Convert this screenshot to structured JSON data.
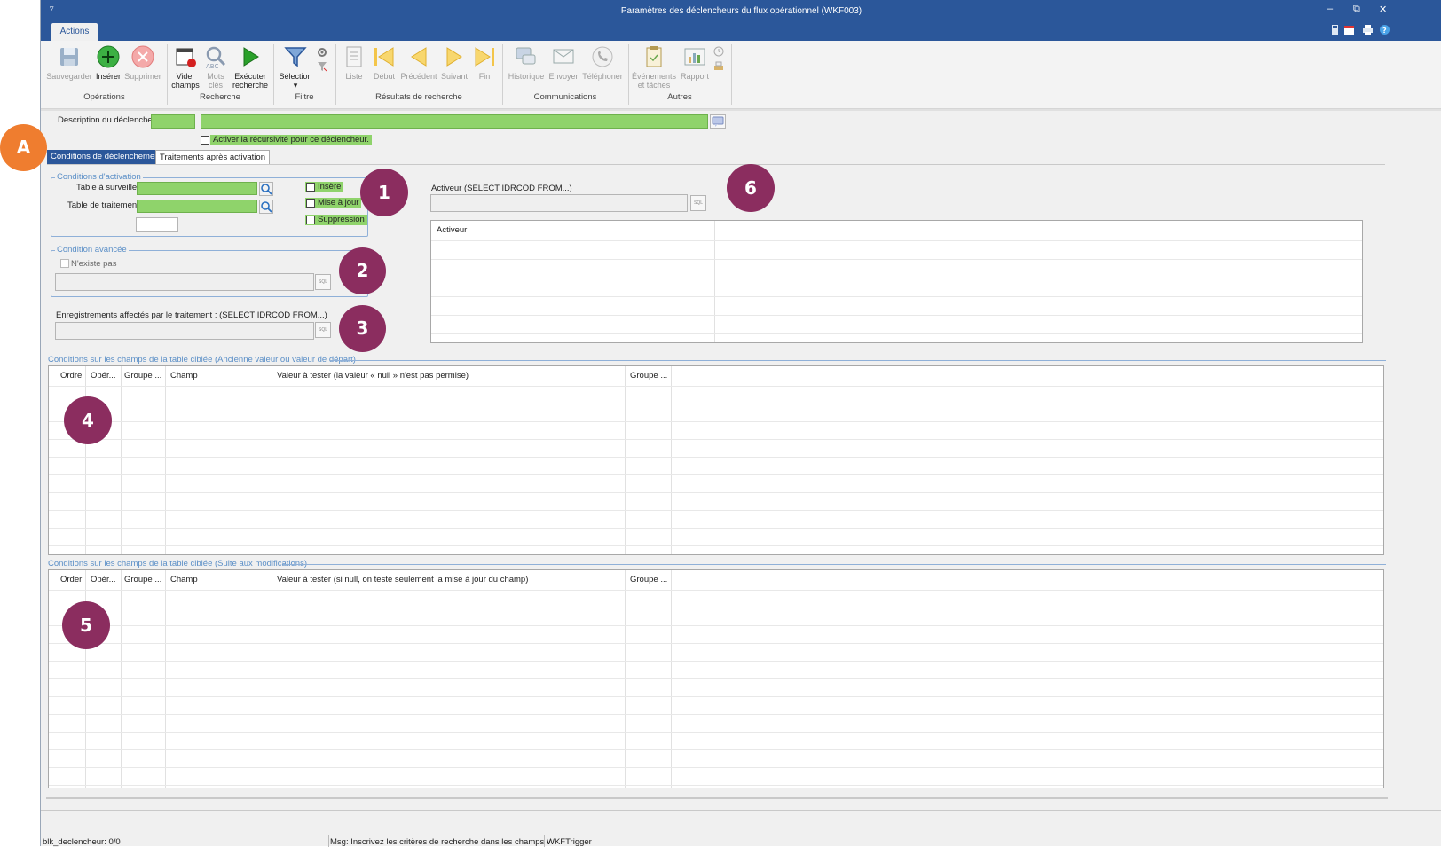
{
  "window": {
    "title": "Paramètres des déclencheurs du flux opérationnel (WKF003)",
    "quick_access": "▿",
    "controls": {
      "minimize": "–",
      "restore": "⧉",
      "close": "✕"
    }
  },
  "ribbon": {
    "tab": "Actions",
    "groups": {
      "operations": "Opérations",
      "recherche": "Recherche",
      "filtre": "Filtre",
      "resultats": "Résultats de recherche",
      "communications": "Communications",
      "autres": "Autres"
    },
    "buttons": {
      "sauvegarder": "Sauvegarder",
      "inserer": "Insérer",
      "supprimer": "Supprimer",
      "vider_1": "Vider",
      "vider_2": "champs",
      "mots_1": "Mots",
      "mots_2": "clés",
      "executer_1": "Exécuter",
      "executer_2": "recherche",
      "selection": "Sélection",
      "selection_arrow": "▾",
      "liste": "Liste",
      "debut": "Début",
      "precedent": "Précédent",
      "suivant": "Suivant",
      "fin": "Fin",
      "historique": "Historique",
      "envoyer": "Envoyer",
      "telephoner": "Téléphoner",
      "evenements_1": "Événements",
      "evenements_2": "et tâches",
      "rapport": "Rapport"
    }
  },
  "form": {
    "description_label": "Description du déclencheur",
    "recursivite_label": "Activer la récursivité pour ce déclencheur.",
    "tabs": [
      "Conditions de déclenchement",
      "Traitements après activation"
    ],
    "activation": {
      "legend": "Conditions d'activation",
      "table_surveiller": "Table à surveiller",
      "table_traitement": "Table de traitement",
      "insere": "Insère",
      "mise_a_jour": "Mise à jour",
      "suppression": "Suppression"
    },
    "avancee": {
      "legend": "Condition avancée",
      "nexiste_pas": "N'existe pas"
    },
    "enregistrements_label": "Enregistrements affectés par le traitement : (SELECT IDRCOD FROM...)",
    "activeur_label": "Activeur (SELECT IDRCOD FROM...)",
    "sql_icon_text": "SQL",
    "activeur_grid_header": "Activeur",
    "conditions_ancienne_title": "Conditions sur les champs de la table ciblée (Ancienne valeur ou valeur de départ)",
    "grid1_headers": [
      "Ordre",
      "Opér...",
      "Groupe ...",
      "Champ",
      "Valeur à tester (la valeur « null » n'est pas permise)",
      "Groupe ..."
    ],
    "conditions_suite_title": "Conditions sur les champs de la table ciblée (Suite aux modifications)",
    "grid2_headers": [
      "Order",
      "Opér...",
      "Groupe ...",
      "Champ",
      "Valeur à tester (si null, on teste seulement la mise à jour du champ)",
      "Groupe ..."
    ]
  },
  "badges": {
    "a": "A",
    "b1": "1",
    "b2": "2",
    "b3": "3",
    "b4": "4",
    "b5": "5",
    "b6": "6"
  },
  "status": {
    "left": "blk_declencheur: 0/0",
    "msg": "Msg: Inscrivez les critères de recherche dans les champs v",
    "table": "WKFTrigger"
  },
  "colors": {
    "titlebar": "#2b579a",
    "required_field": "#8fd36b",
    "badge_purple": "#8b2d5f",
    "badge_orange": "#ef7d2f",
    "legend_blue": "#5b8fc7"
  }
}
